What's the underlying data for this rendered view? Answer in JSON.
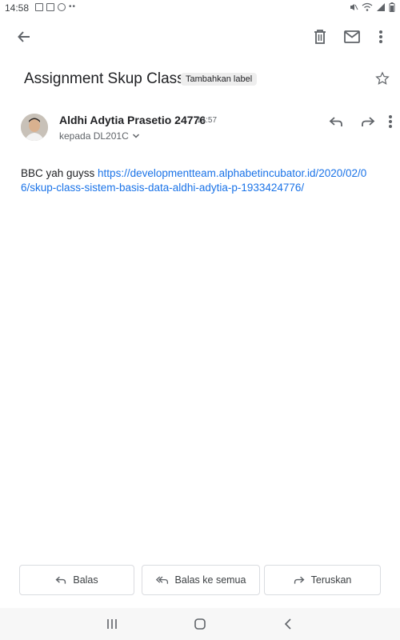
{
  "status_bar": {
    "time": "14:58",
    "left_icons": [
      "gallery-icon",
      "gallery-icon",
      "chrome-icon"
    ],
    "right_icons": [
      "mute-icon",
      "wifi-icon",
      "signal-icon",
      "battery-icon"
    ]
  },
  "toolbar": {
    "icons": [
      "back-arrow-icon",
      "trash-icon",
      "mail-icon",
      "more-vert-icon"
    ]
  },
  "email": {
    "subject": "Assignment Skup Class",
    "label_chip": "Tambahkan label",
    "sender_name": "Aldhi Adytia Prasetio 24776",
    "time": "14:57",
    "recipient": "kepada DL201C",
    "body_text": "BBC yah guyss ",
    "body_link": "https://developmentteam.alphabetincubator.id/2020/02/06/skup-class-sistem-basis-data-aldhi-adytia-p-1933424776/"
  },
  "actions": {
    "reply": "Balas",
    "reply_all": "Balas ke semua",
    "forward": "Teruskan"
  },
  "colors": {
    "link": "#1a73e8",
    "text": "#202124",
    "muted": "#5f6368",
    "border": "#dadce0"
  }
}
